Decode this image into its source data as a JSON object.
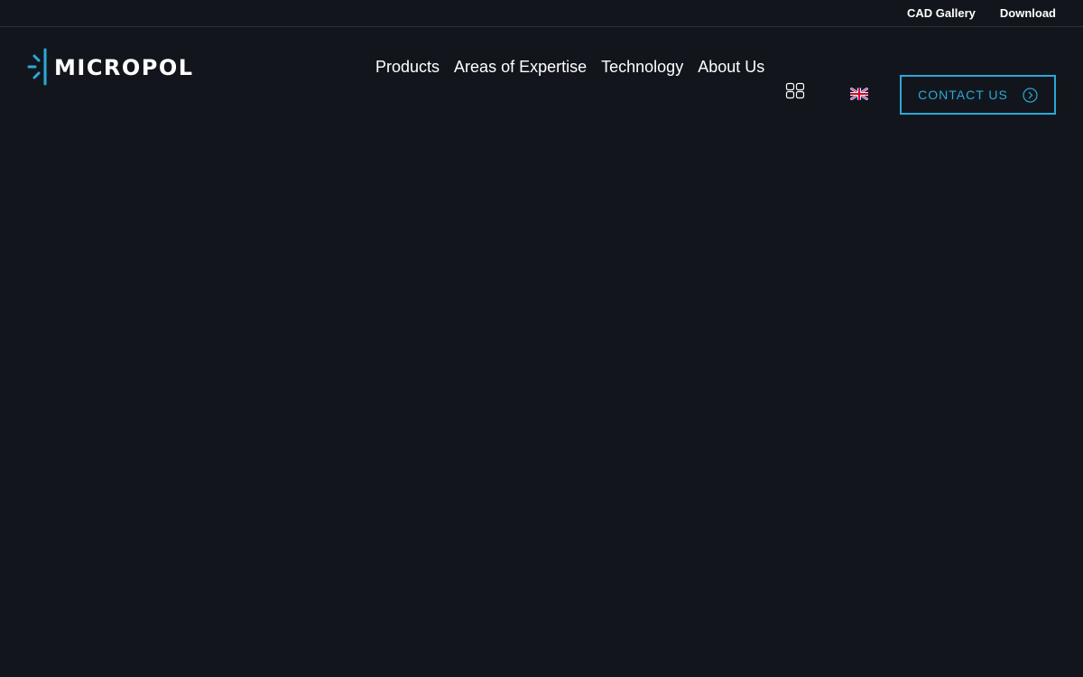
{
  "topbar": {
    "links": [
      {
        "label": "CAD Gallery"
      },
      {
        "label": "Download"
      }
    ]
  },
  "logo": {
    "text": "MICROPOL",
    "accent_color": "#2aa9d8"
  },
  "nav": {
    "items": [
      {
        "label": "Products"
      },
      {
        "label": "Areas of Expertise"
      },
      {
        "label": "Technology"
      },
      {
        "label": "About Us"
      }
    ]
  },
  "icons": {
    "grid": "grid-menu-icon",
    "language": "uk-flag-icon",
    "arrow": "circle-arrow-right-icon"
  },
  "contact": {
    "label": "CONTACT US"
  },
  "colors": {
    "background": "#12161c",
    "accent": "#2aa9d8"
  }
}
